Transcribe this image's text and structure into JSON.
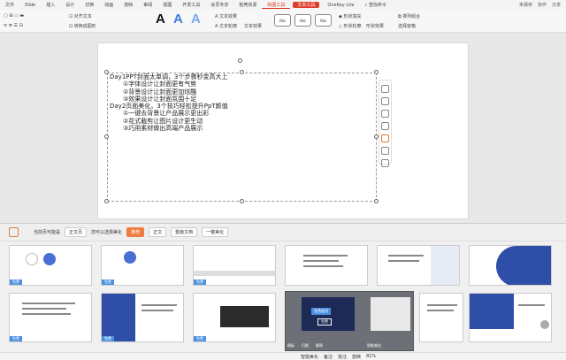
{
  "menubar": {
    "items": [
      "文件",
      "Slide",
      "插入",
      "设计",
      "切换",
      "动画",
      "放映",
      "审阅",
      "视图",
      "开发工具",
      "会员专享",
      "稻壳资源"
    ],
    "red_tabs": [
      "绘图工具",
      "文本工具"
    ],
    "extra": "OneKey Lite",
    "search": "查找命令",
    "right": [
      "未保存",
      "协作",
      "分享"
    ]
  },
  "ribbon": {
    "row1": [
      "对齐文本",
      "文本框",
      "文本效果"
    ],
    "row2": [
      "转换成图形",
      "文本轮廓",
      "文本效果",
      "形状填充",
      "形状效果",
      "形状轮廓"
    ],
    "a_letters": [
      "A",
      "A",
      "A"
    ],
    "abc": [
      "Abc",
      "Abc",
      "Abc"
    ],
    "right": [
      "排列组合",
      "选择窗格"
    ],
    "a_colors": [
      "#111111",
      "#3d7be0",
      "#7aa7e8"
    ]
  },
  "slide": {
    "lines": [
      {
        "text": "Day1PPT封面太单调，3个步骤秒变高大上",
        "indent": 1
      },
      {
        "text": "①字体设计让封面更有气势",
        "indent": 2
      },
      {
        "text": "②背景设计让封面更加炫酷",
        "indent": 2
      },
      {
        "text": "③效果设计让封面氛围十足",
        "indent": 2
      },
      {
        "text": "Day2页面美化，3个技巧轻松提升PpT颜值",
        "indent": 1
      },
      {
        "text": "①一键去背景让产品展示更出彩",
        "indent": 2
      },
      {
        "text": "②花式截剪让图片设计更生动",
        "indent": 2
      },
      {
        "text": "③巧用素材做出高端产品展示",
        "indent": 2
      }
    ]
  },
  "panel": {
    "chips": [
      "当前页可能是",
      "正文页",
      "您可以选择美化",
      "推荐",
      "正文",
      "整篇文档",
      "一键美化"
    ],
    "badges": [
      "免费",
      "免费",
      "免费",
      "免费",
      "免费",
      "免费"
    ],
    "card_text": "免费使用",
    "card_btn": "免费",
    "card_tab": "正文页",
    "thumb_footer": [
      "模板",
      "扫图",
      "解释",
      "智能美化"
    ]
  },
  "statusbar": {
    "items": [
      "智能美化",
      "备注",
      "批注",
      "放映",
      "81%"
    ]
  }
}
